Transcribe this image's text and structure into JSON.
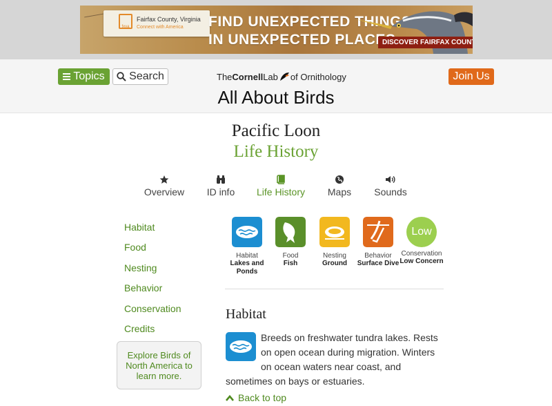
{
  "ad": {
    "tag_title": "Fairfax County, Virginia",
    "tag_sub": "Connect with America",
    "tag_logo": "fxva",
    "headline_line1": "FIND UNEXPECTED THINGS",
    "headline_line2": "IN UNEXPECTED PLACES.",
    "cta": "DISCOVER FAIRFAX COUNTY!"
  },
  "header": {
    "topics_label": "Topics",
    "search_label": "Search",
    "join_label": "Join Us",
    "logo_the": "The",
    "logo_cornell": "Cornell",
    "logo_lab": "Lab",
    "logo_of": "of Ornithology",
    "site_title": "All About Birds"
  },
  "title": {
    "species": "Pacific Loon",
    "page": "Life History"
  },
  "tabs": [
    {
      "label": "Overview",
      "icon": "star-icon"
    },
    {
      "label": "ID info",
      "icon": "binoculars-icon"
    },
    {
      "label": "Life History",
      "icon": "book-icon",
      "active": true
    },
    {
      "label": "Maps",
      "icon": "globe-icon"
    },
    {
      "label": "Sounds",
      "icon": "speaker-icon"
    }
  ],
  "sidebar": {
    "links": [
      "Habitat",
      "Food",
      "Nesting",
      "Behavior",
      "Conservation",
      "Credits"
    ],
    "explore": "Explore Birds of North America to learn more."
  },
  "summary": [
    {
      "category": "Habitat",
      "value": "Lakes and Ponds",
      "icon": "water-icon",
      "color": "#1c8ed1"
    },
    {
      "category": "Food",
      "value": "Fish",
      "icon": "fish-icon",
      "color": "#5a8f2a"
    },
    {
      "category": "Nesting",
      "value": "Ground",
      "icon": "ground-nest-icon",
      "color": "#f2b81f"
    },
    {
      "category": "Behavior",
      "value": "Surface Dive",
      "icon": "surface-dive-icon",
      "color": "#e06a1c"
    },
    {
      "category": "Conservation",
      "value": "Low Concern",
      "badge": "Low",
      "color": "#9ccf4f"
    }
  ],
  "habitat": {
    "heading": "Habitat",
    "text": "Breeds on freshwater tundra lakes. Rests on open ocean during migration. Winters on ocean waters near coast, and sometimes on bays or estuaries.",
    "back_to_top": "Back to top"
  }
}
